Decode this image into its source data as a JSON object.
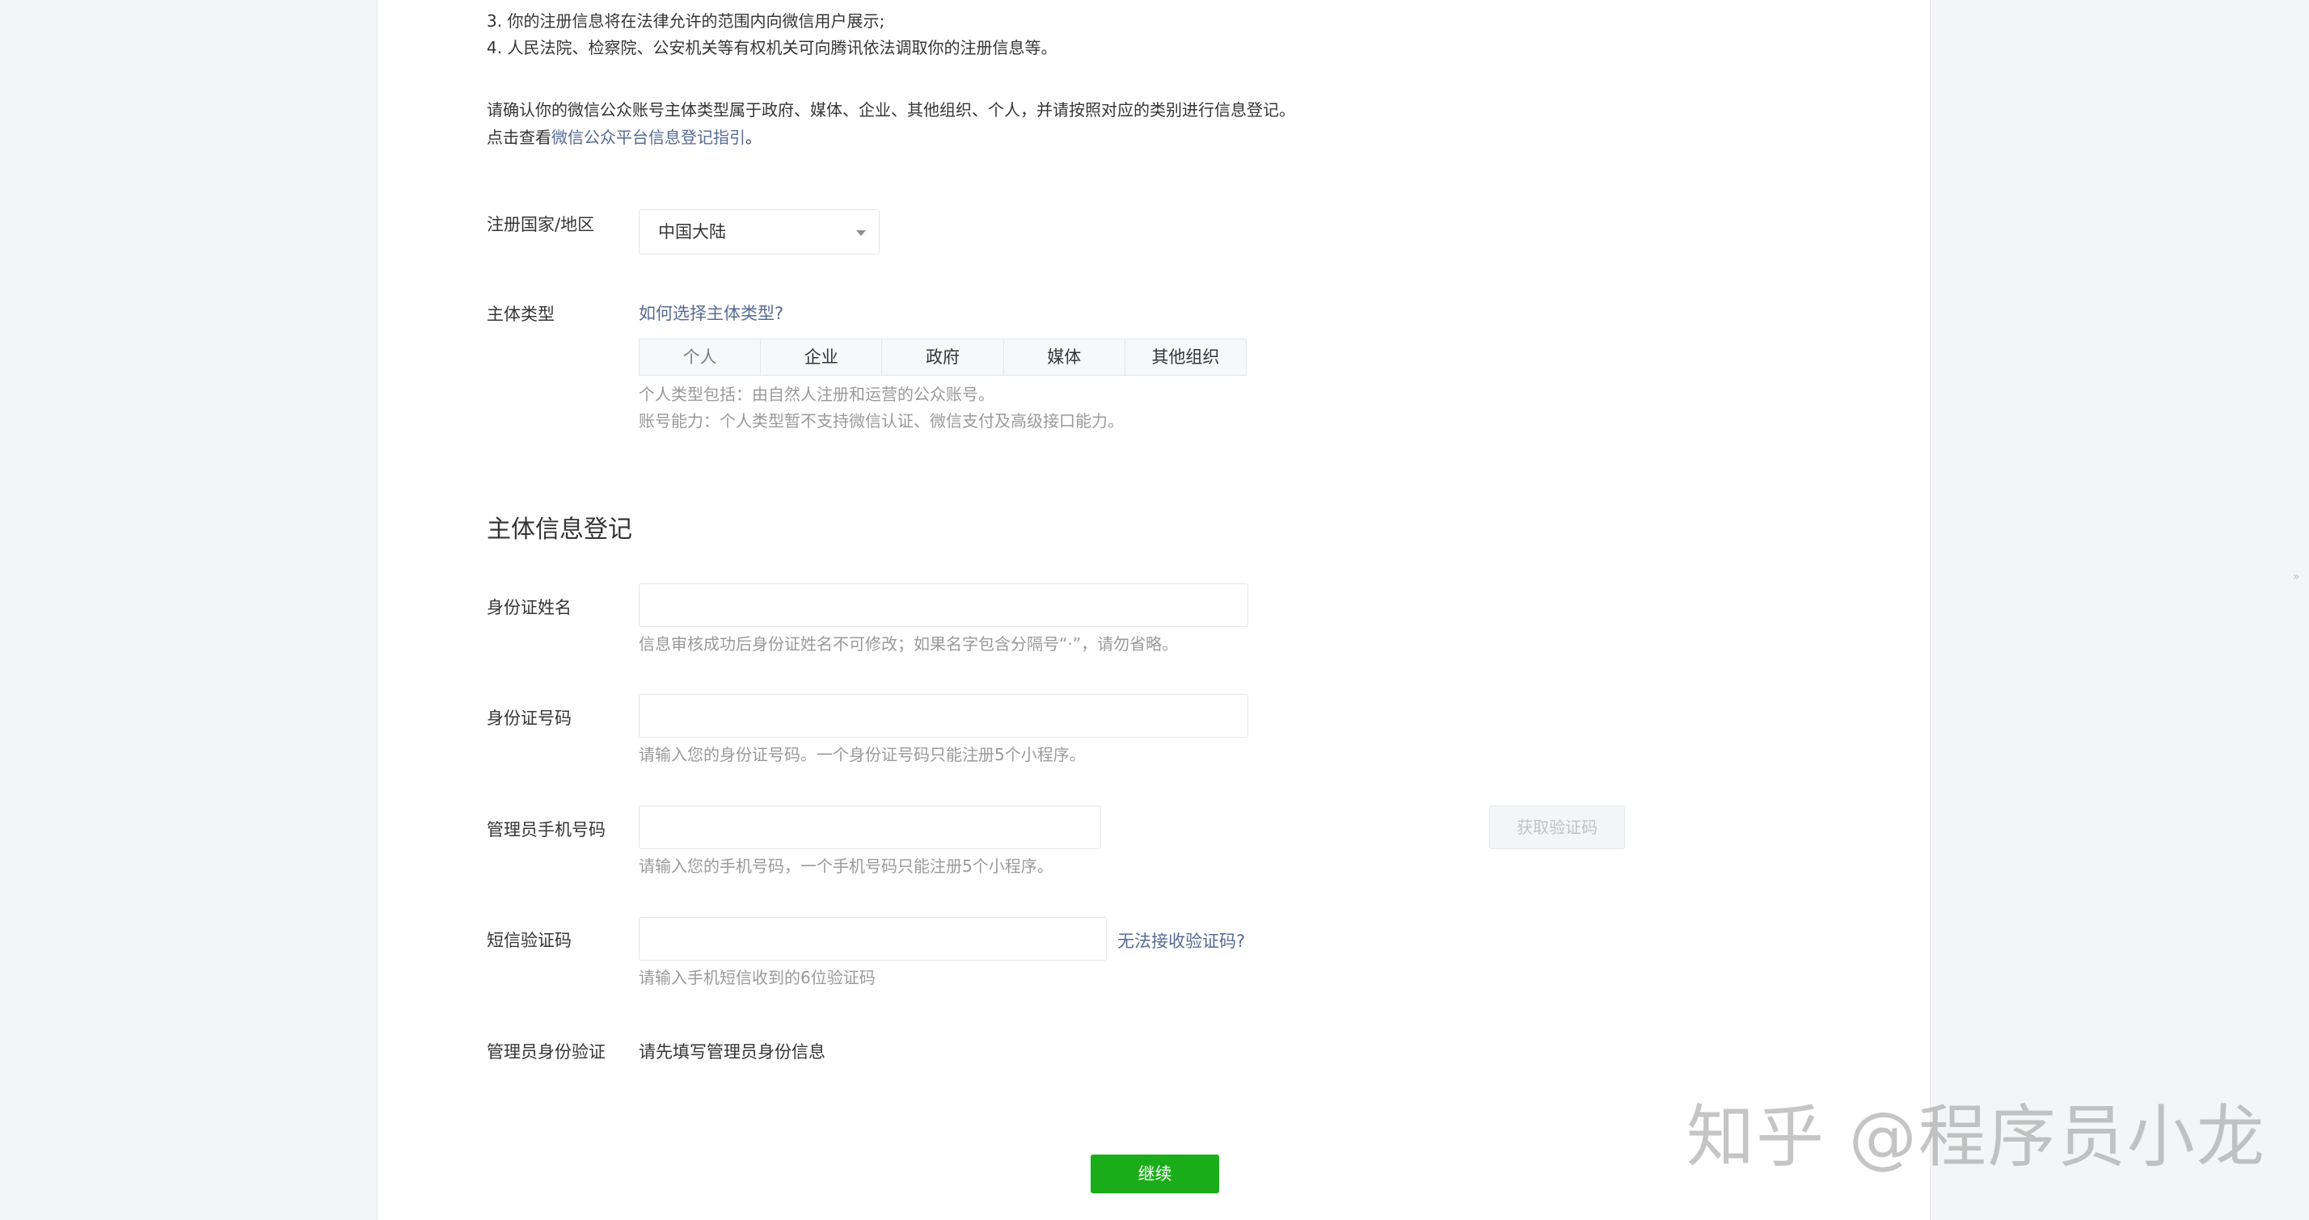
{
  "notice": {
    "line1": "3. 你的注册信息将在法律允许的范围内向微信用户展示;",
    "line2": "4. 人民法院、检察院、公安机关等有权机关可向腾讯依法调取你的注册信息等。",
    "line3": "请确认你的微信公众账号主体类型属于政府、媒体、企业、其他组织、个人，并请按照对应的类别进行信息登记。",
    "line4_prefix": "点击查看",
    "line4_link": "微信公众平台信息登记指引",
    "line4_suffix": "。"
  },
  "region": {
    "label": "注册国家/地区",
    "value": "中国大陆"
  },
  "subject_type": {
    "label": "主体类型",
    "help_link": "如何选择主体类型?",
    "options": [
      "个人",
      "企业",
      "政府",
      "媒体",
      "其他组织"
    ],
    "selected": "个人",
    "tip1": "个人类型包括：由自然人注册和运营的公众账号。",
    "tip2": "账号能力：个人类型暂不支持微信认证、微信支付及高级接口能力。"
  },
  "section_title": "主体信息登记",
  "id_name": {
    "label": "身份证姓名",
    "tip": "信息审核成功后身份证姓名不可修改；如果名字包含分隔号“·”，请勿省略。"
  },
  "id_number": {
    "label": "身份证号码",
    "tip": "请输入您的身份证号码。一个身份证号码只能注册5个小程序。"
  },
  "phone": {
    "label": "管理员手机号码",
    "button": "获取验证码",
    "tip": "请输入您的手机号码，一个手机号码只能注册5个小程序。"
  },
  "sms": {
    "label": "短信验证码",
    "help_link": "无法接收验证码?",
    "tip": "请输入手机短信收到的6位验证码"
  },
  "admin_verify": {
    "label": "管理员身份验证",
    "value": "请先填写管理员身份信息"
  },
  "continue_button": "继续",
  "watermark": "知乎 @程序员小龙",
  "colors": {
    "link": "#576b95",
    "primary_button": "#1aad19",
    "tip_text": "#9a9a9a",
    "page_bg": "#f3f5f7"
  }
}
